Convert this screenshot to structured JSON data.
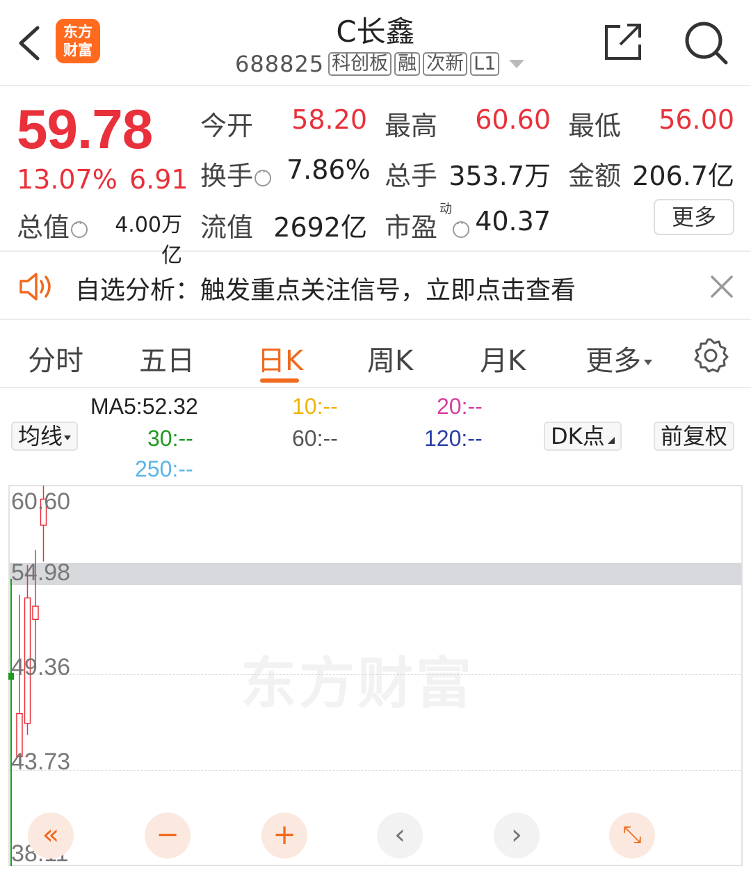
{
  "header": {
    "logo_line1": "东方",
    "logo_line2": "财富",
    "stock_name": "C长鑫",
    "stock_code": "688825",
    "tags": [
      "科创板",
      "融",
      "次新",
      "L1"
    ]
  },
  "quote": {
    "price": "59.78",
    "change_pct": "13.07%",
    "change_amt": "6.91",
    "fields": {
      "open": {
        "label": "今开",
        "value": "58.20"
      },
      "high": {
        "label": "最高",
        "value": "60.60"
      },
      "low": {
        "label": "最低",
        "value": "56.00"
      },
      "turnover": {
        "label": "换手",
        "value": "7.86%"
      },
      "volume": {
        "label": "总手",
        "value": "353.7万"
      },
      "amount": {
        "label": "金额",
        "value": "206.7亿"
      },
      "market_cap": {
        "label": "总值",
        "value": "4.00万亿"
      },
      "float_cap": {
        "label": "流值",
        "value": "2692亿"
      },
      "pe": {
        "label": "市盈",
        "sup": "动",
        "value": "40.37"
      }
    },
    "more_label": "更多"
  },
  "banner": {
    "text": "自选分析：触发重点关注信号，立即点击查看"
  },
  "tabs": [
    "分时",
    "五日",
    "日K",
    "周K",
    "月K",
    "更多"
  ],
  "active_tab": "日K",
  "ma_legend": {
    "ma5": "MA5:52.32",
    "ma10": "10:--",
    "ma20": "20:--",
    "ma30": "30:--",
    "ma60": "60:--",
    "ma120": "120:--",
    "ma250": "250:--",
    "colors": {
      "ma5": "#222222",
      "ma10": "#f0b400",
      "ma20": "#d63fa0",
      "ma30": "#1f9b1f",
      "ma60": "#555555",
      "ma120": "#2a3fa8",
      "ma250": "#5ab4e6"
    }
  },
  "controls": {
    "indicator_label": "均线",
    "dk_label": "DK点",
    "adjust_label": "前复权"
  },
  "chart_data": {
    "type": "candlestick",
    "y_ticks": [
      "60.60",
      "54.98",
      "49.36",
      "43.73",
      "38.11"
    ],
    "ylim": [
      38.11,
      60.6
    ],
    "highlight_price": 54.98,
    "candles": [
      {
        "open": 44.2,
        "close": 46.8,
        "high": 54.0,
        "low": 43.7
      },
      {
        "open": 46.2,
        "close": 53.8,
        "high": 55.8,
        "low": 45.5
      },
      {
        "open": 52.5,
        "close": 53.3,
        "high": 56.7,
        "low": 49.6
      },
      {
        "open": 58.2,
        "close": 59.78,
        "high": 60.6,
        "low": 56.0
      }
    ],
    "volume_bar_color": "#1f9b1f"
  },
  "watermark": "东方财富",
  "colors": {
    "up": "#e8313b",
    "accent": "#f06a1e"
  }
}
